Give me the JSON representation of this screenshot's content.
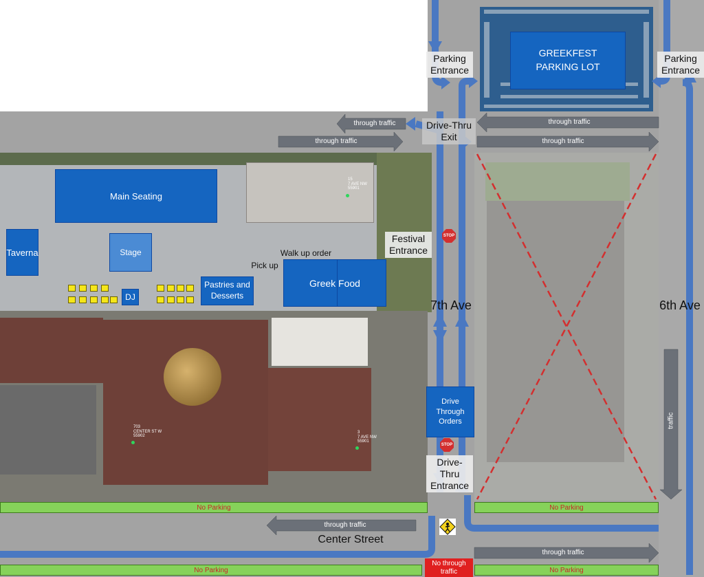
{
  "lot": {
    "title": "GREEKFEST\nPARKING LOT"
  },
  "venue": {
    "main_seating": "Main Seating",
    "taverna": "Taverna",
    "stage": "Stage",
    "dj": "DJ",
    "pastries": "Pastries and\nDesserts",
    "walk_up": "Walk up order",
    "pick_up": "Pick up",
    "greek_food": "Greek Food"
  },
  "labels": {
    "parking_entrance_left": "Parking\nEntrance",
    "parking_entrance_right": "Parking\nEntrance",
    "drive_thru_exit": "Drive-Thru\nExit",
    "festival_entrance": "Festival\nEntrance",
    "seventh_ave": "7th Ave",
    "sixth_ave": "6th Ave",
    "drive_through_orders": "Drive\nThrough\nOrders",
    "drive_thru_entrance": "Drive-\nThru\nEntrance",
    "center_street": "Center Street",
    "no_through_traffic": "No through\ntraffic"
  },
  "traffic": {
    "top_left_1": "through traffic",
    "top_left_2": "through traffic",
    "top_right_1": "through traffic",
    "top_right_2": "through traffic",
    "right_vertical": "traffic",
    "center_left": "through traffic",
    "bottom_right": "through traffic"
  },
  "no_parking": {
    "top_left": "No Parking",
    "top_right": "No Parking",
    "bottom_left": "No Parking",
    "bottom_right": "No Parking"
  },
  "stop_sign": "STOP",
  "addresses": {
    "a1": "15\n7 AVE NW\n55901",
    "a2": "703\nCENTER ST W\n55902",
    "a3": "3\n7 AVE NW\n55901"
  },
  "colors": {
    "road": "#a9a9a9",
    "arrow_blue": "#4a78c2",
    "arrow_gray": "#6b7078",
    "box_blue": "#1565c0",
    "no_parking_green": "#86d25a",
    "no_parking_text": "#c62828",
    "x_mark": "#d32f2f"
  }
}
